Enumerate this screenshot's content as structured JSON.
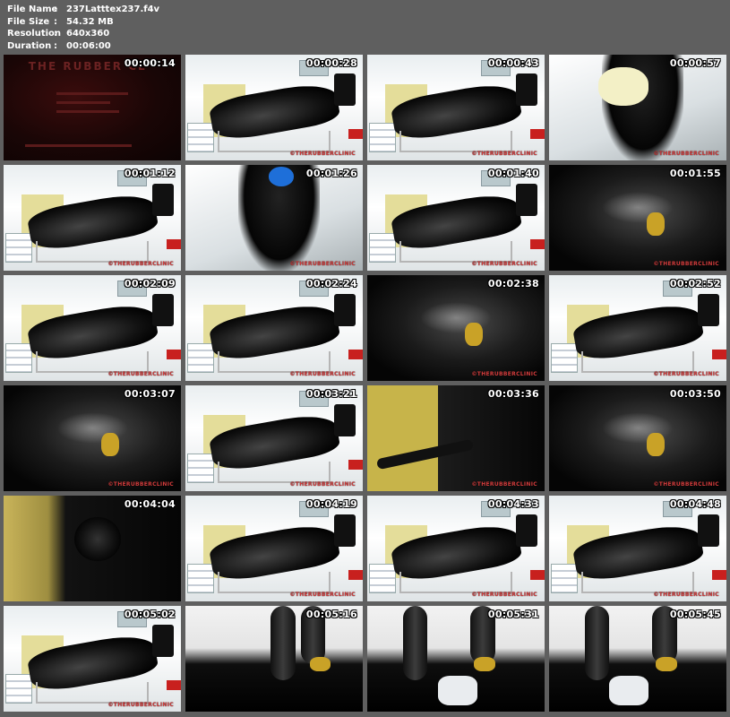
{
  "info": {
    "file_name_label": "File Name",
    "file_name": "237Latttex237.f4v",
    "file_size_label": "File Size",
    "file_size": "54.32 MB",
    "resolution_label": "Resolution",
    "resolution": "640x360",
    "duration_label": "Duration",
    "duration": "00:06:00",
    "separator": ":"
  },
  "watermark": "©THERUBBERCLINIC",
  "title_card_text": "THE RUBBER CL",
  "thumbnails": [
    {
      "timestamp": "00:00:14",
      "scene": "title"
    },
    {
      "timestamp": "00:00:28",
      "scene": "clinic"
    },
    {
      "timestamp": "00:00:43",
      "scene": "clinic"
    },
    {
      "timestamp": "00:00:57",
      "scene": "bright"
    },
    {
      "timestamp": "00:01:12",
      "scene": "clinic"
    },
    {
      "timestamp": "00:01:26",
      "scene": "bright"
    },
    {
      "timestamp": "00:01:40",
      "scene": "clinic"
    },
    {
      "timestamp": "00:01:55",
      "scene": "close"
    },
    {
      "timestamp": "00:02:09",
      "scene": "clinic"
    },
    {
      "timestamp": "00:02:24",
      "scene": "clinic"
    },
    {
      "timestamp": "00:02:38",
      "scene": "close"
    },
    {
      "timestamp": "00:02:52",
      "scene": "clinic"
    },
    {
      "timestamp": "00:03:07",
      "scene": "close"
    },
    {
      "timestamp": "00:03:21",
      "scene": "clinic"
    },
    {
      "timestamp": "00:03:36",
      "scene": "yellowwall"
    },
    {
      "timestamp": "00:03:50",
      "scene": "close"
    },
    {
      "timestamp": "00:04:04",
      "scene": "gasmask"
    },
    {
      "timestamp": "00:04:19",
      "scene": "clinic"
    },
    {
      "timestamp": "00:04:33",
      "scene": "clinic"
    },
    {
      "timestamp": "00:04:48",
      "scene": "clinic"
    },
    {
      "timestamp": "00:05:02",
      "scene": "clinic"
    },
    {
      "timestamp": "00:05:16",
      "scene": "limbs"
    },
    {
      "timestamp": "00:05:31",
      "scene": "limbs"
    },
    {
      "timestamp": "00:05:45",
      "scene": "limbs"
    }
  ]
}
